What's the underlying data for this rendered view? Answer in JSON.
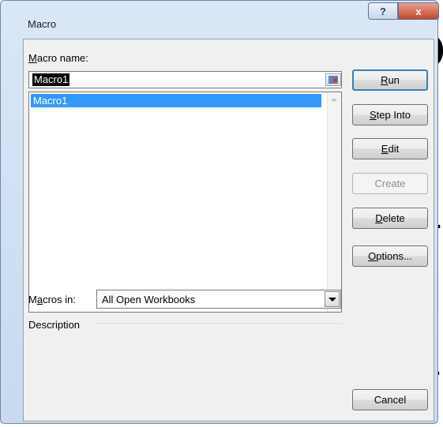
{
  "background_text": [
    "o",
    "n",
    "l"
  ],
  "window": {
    "title": "Macro",
    "help_label": "?",
    "close_label": "x"
  },
  "macro_name": {
    "label_prefix": "",
    "label_mnemonic": "M",
    "label_rest": "acro name:",
    "value": "Macro1"
  },
  "macro_list": {
    "items": [
      "Macro1"
    ],
    "selected_index": 0
  },
  "macros_in": {
    "label_prefix": "M",
    "label_mnemonic": "a",
    "label_rest": "cros in:",
    "value": "All Open Workbooks"
  },
  "description": {
    "label": "Description"
  },
  "buttons": {
    "run": {
      "mnemonic": "R",
      "rest": "un"
    },
    "step_into": {
      "mnemonic": "S",
      "rest": "tep Into"
    },
    "edit": {
      "mnemonic": "E",
      "rest": "dit"
    },
    "create": {
      "label": "Create"
    },
    "delete": {
      "mnemonic": "D",
      "rest": "elete"
    },
    "options": {
      "mnemonic": "O",
      "rest": "ptions..."
    },
    "cancel": {
      "label": "Cancel"
    }
  }
}
